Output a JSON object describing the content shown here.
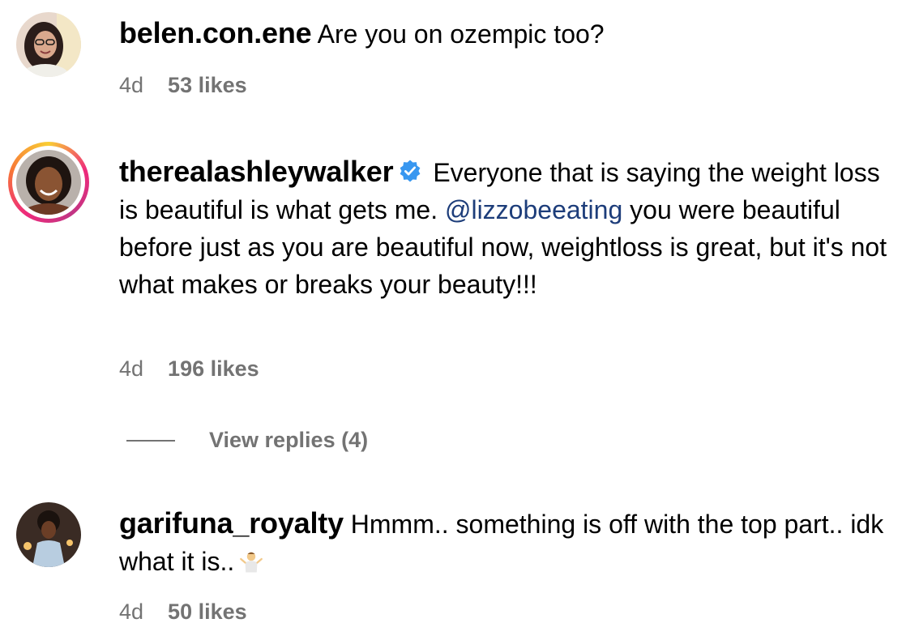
{
  "comments": [
    {
      "username": "belen.con.ene",
      "verified": false,
      "text": "Are you on ozempic too?",
      "age": "4d",
      "likes": "53 likes"
    },
    {
      "username": "therealashleywalker",
      "verified": true,
      "text_before": "Everyone that is saying the weight loss is beautiful is what gets me.",
      "mention": "@lizzobeeating",
      "text_after": "you were beautiful before just as you are beautiful now, weightloss is great, but it's not what makes or breaks your beauty!!!",
      "age": "4d",
      "likes": "196 likes",
      "view_replies": "View replies (4)"
    },
    {
      "username": "garifuna_royalty",
      "verified": false,
      "text": "Hmmm.. something is off with the top part.. idk what it is..",
      "emoji": "person-shrugging",
      "age": "4d",
      "likes": "50 likes"
    }
  ],
  "colors": {
    "meta": "#737373",
    "mention": "#1d3d7a",
    "verified": "#3897f0"
  }
}
